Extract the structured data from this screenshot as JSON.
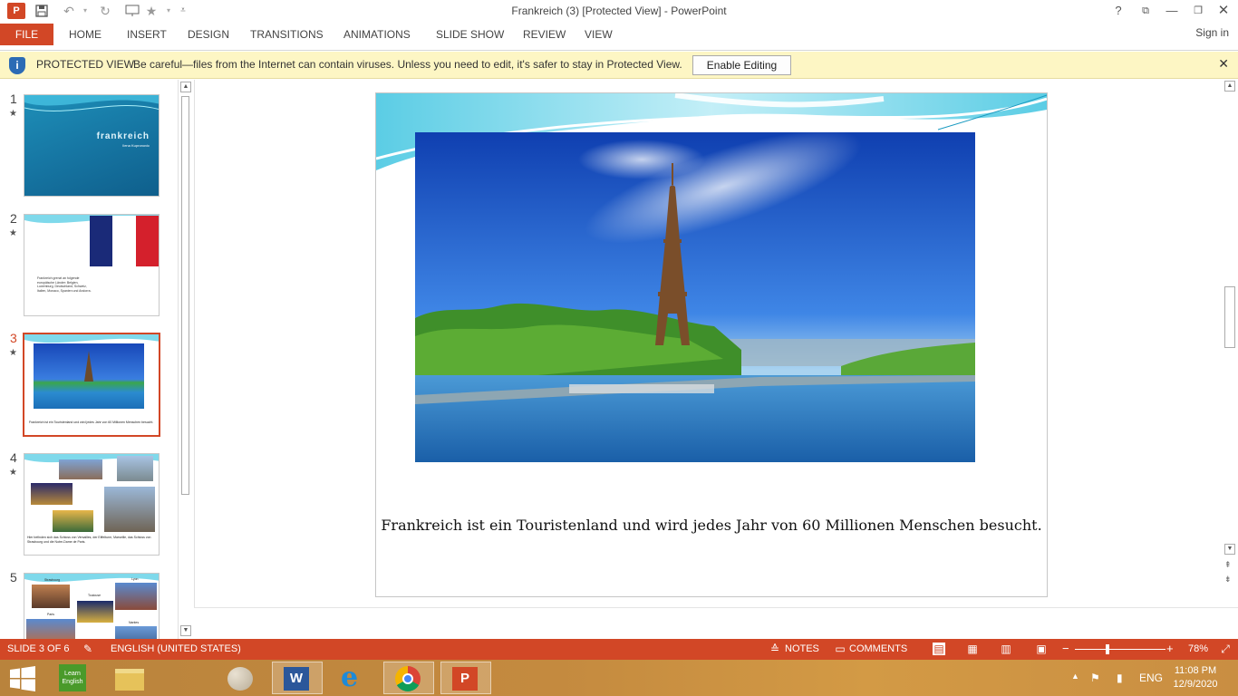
{
  "app": {
    "window_title": "Frankreich (3) [Protected View] - PowerPoint",
    "logo_letter": "P"
  },
  "ribbon": {
    "file_label": "FILE",
    "tabs": [
      "HOME",
      "INSERT",
      "DESIGN",
      "TRANSITIONS",
      "ANIMATIONS",
      "SLIDE SHOW",
      "REVIEW",
      "VIEW"
    ],
    "sign_in": "Sign in"
  },
  "protected_view": {
    "title": "PROTECTED VIEW",
    "message": "Be careful—files from the Internet can contain viruses. Unless you need to edit, it's safer to stay in Protected View.",
    "button": "Enable Editing",
    "close": "✕"
  },
  "thumbnails": [
    {
      "number": "1",
      "star": "★",
      "title": "frankreich",
      "subtitle": "Ilena Kupronovic"
    },
    {
      "number": "2",
      "star": "★",
      "text": "Frankreich grenzt an folgende europäische Länder: Belgien, Luxemburg, Deutschland, Schweiz, Italien, Monaco, Spanien und Andorra."
    },
    {
      "number": "3",
      "star": "★",
      "text": "Frankreich ist ein Touristenland und wird jedes Jahr von 60 Millionen Menschen besucht.",
      "selected": true
    },
    {
      "number": "4",
      "star": "★",
      "text": "Hier befinden sich das Schloss von Versailles, der Eiffelturm, Marseille, das Schloss von Strasbourg und die Notre-Dame de Paris."
    },
    {
      "number": "5",
      "star": "",
      "labels": [
        "Strasbourg",
        "Lyon",
        "Toulouse",
        "Paris",
        "Nantes"
      ]
    }
  ],
  "slide": {
    "caption": "Frankreich ist ein Touristenland und wird jedes Jahr von 60 Millionen Menschen besucht."
  },
  "status": {
    "slide_indicator": "SLIDE 3 OF 6",
    "language": "ENGLISH (UNITED STATES)",
    "notes": "NOTES",
    "comments": "COMMENTS",
    "zoom": "78%",
    "zoom_minus": "−",
    "zoom_plus": "+"
  },
  "taskbar": {
    "learn_english_label": "Learn English",
    "language": "ENG",
    "time": "11:08 PM",
    "date": "12/9/2020"
  },
  "colors": {
    "accent": "#d24726",
    "protected_bar": "#fdf6c4",
    "taskbar": "#c48a3f"
  }
}
